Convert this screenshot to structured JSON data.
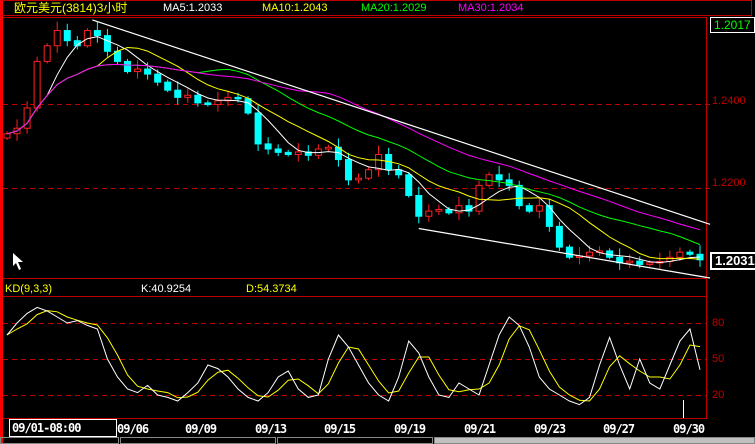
{
  "header": {
    "symbol": "欧元美元(3814)3小时",
    "ma5": "MA5:1.2033",
    "ma10": "MA10:1.2043",
    "ma20": "MA20:1.2029",
    "ma30": "MA30:1.2034"
  },
  "price_axis": {
    "ticks": [
      "1.2400",
      "1.2200"
    ],
    "top_price": "1.2017",
    "last_price": "1.2031"
  },
  "kd": {
    "label": "KD(9,3,3)",
    "k_text": "K:40.9254",
    "d_text": "D:54.3734",
    "ticks": [
      "80",
      "50",
      "20"
    ]
  },
  "dates": {
    "cursor": "09/01-08:00",
    "labels": [
      "09/06",
      "09/09",
      "09/13",
      "09/15",
      "09/19",
      "09/21",
      "09/23",
      "09/27",
      "09/30"
    ]
  },
  "colors": {
    "up": "#ff2020",
    "down": "#00ffff",
    "ma5": "#ffffff",
    "ma10": "#ffff00",
    "ma20": "#00ff00",
    "ma30": "#ff00ff",
    "grid": "#c00000"
  },
  "chart_data": {
    "type": "candlestick",
    "title": "欧元美元(3814)3小时",
    "ylim": [
      1.1988,
      1.2605
    ],
    "closes": [
      1.2329,
      1.2342,
      1.239,
      1.25,
      1.2537,
      1.2573,
      1.2549,
      1.2537,
      1.2573,
      1.2561,
      1.2524,
      1.25,
      1.2476,
      1.2482,
      1.247,
      1.2451,
      1.2432,
      1.2415,
      1.242,
      1.2402,
      1.2398,
      1.2407,
      1.2415,
      1.2412,
      1.2378,
      1.2305,
      1.2293,
      1.2285,
      1.228,
      1.2286,
      1.2278,
      1.2293,
      1.2297,
      1.2268,
      1.222,
      1.2224,
      1.2244,
      1.228,
      1.2244,
      1.2232,
      1.2183,
      1.2134,
      1.2146,
      1.215,
      1.2142,
      1.2159,
      1.2146,
      1.2207,
      1.2232,
      1.222,
      1.2207,
      1.2159,
      1.2146,
      1.2159,
      1.211,
      1.2061,
      1.2037,
      1.204,
      1.2049,
      1.2052,
      1.2037,
      1.2024,
      1.2028,
      1.202,
      1.2024,
      1.2027,
      1.2037,
      1.2049,
      1.2044,
      1.2031
    ],
    "trendlines": [
      {
        "name": "upper",
        "from": [
          8.5,
          1.2598
        ],
        "to": [
          70,
          1.2115
        ]
      },
      {
        "name": "lower",
        "from": [
          41,
          1.2105
        ],
        "to": [
          70,
          1.1988
        ]
      }
    ],
    "kd_ylim": [
      0,
      100
    ],
    "k": [
      70,
      80,
      88,
      93,
      90,
      85,
      80,
      82,
      78,
      75,
      50,
      35,
      25,
      22,
      28,
      20,
      18,
      15,
      22,
      30,
      45,
      42,
      35,
      25,
      18,
      15,
      22,
      35,
      40,
      25,
      18,
      20,
      50,
      70,
      60,
      45,
      30,
      20,
      15,
      35,
      65,
      55,
      35,
      20,
      18,
      30,
      25,
      20,
      45,
      70,
      85,
      78,
      60,
      35,
      25,
      20,
      15,
      12,
      18,
      45,
      68,
      45,
      25,
      50,
      30,
      25,
      45,
      65,
      75,
      41
    ]
  }
}
